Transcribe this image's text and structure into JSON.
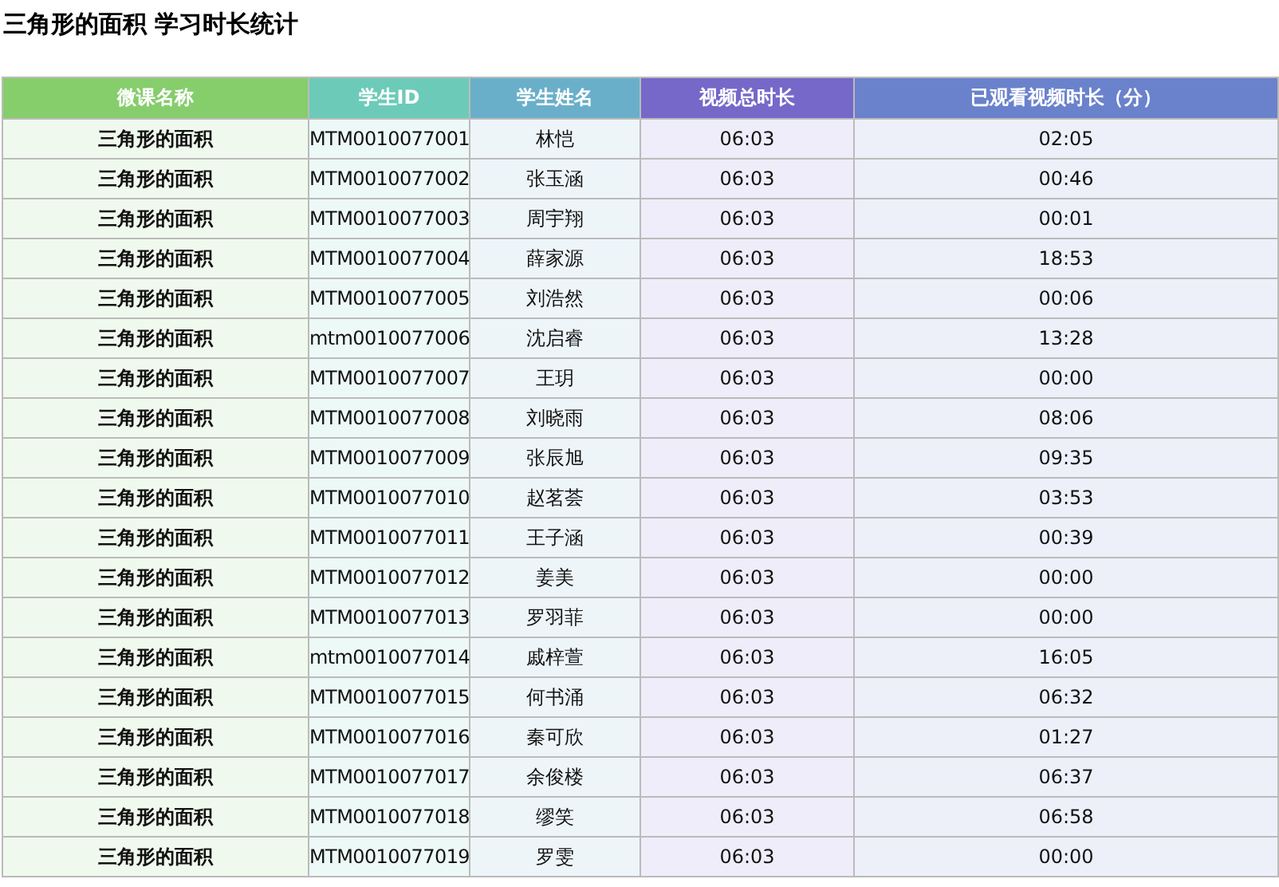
{
  "title": "三角形的面积 学习时长统计",
  "table": {
    "columns": [
      {
        "label": "微课名称",
        "color": "#86cd6c"
      },
      {
        "label": "学生ID",
        "color": "#6ccbb8"
      },
      {
        "label": "学生姓名",
        "color": "#6aafc9"
      },
      {
        "label": "视频总时长",
        "color": "#7568c9"
      },
      {
        "label": "已观看视频时长（分）",
        "color": "#6a82cc"
      }
    ],
    "rows": [
      [
        "三角形的面积",
        "MTM0010077001",
        "林恺",
        "06:03",
        "02:05"
      ],
      [
        "三角形的面积",
        "MTM0010077002",
        "张玉涵",
        "06:03",
        "00:46"
      ],
      [
        "三角形的面积",
        "MTM0010077003",
        "周宇翔",
        "06:03",
        "00:01"
      ],
      [
        "三角形的面积",
        "MTM0010077004",
        "薛家源",
        "06:03",
        "18:53"
      ],
      [
        "三角形的面积",
        "MTM0010077005",
        "刘浩然",
        "06:03",
        "00:06"
      ],
      [
        "三角形的面积",
        "mtm0010077006",
        "沈启睿",
        "06:03",
        "13:28"
      ],
      [
        "三角形的面积",
        "MTM0010077007",
        "王玥",
        "06:03",
        "00:00"
      ],
      [
        "三角形的面积",
        "MTM0010077008",
        "刘晓雨",
        "06:03",
        "08:06"
      ],
      [
        "三角形的面积",
        "MTM0010077009",
        "张辰旭",
        "06:03",
        "09:35"
      ],
      [
        "三角形的面积",
        "MTM0010077010",
        "赵茗荟",
        "06:03",
        "03:53"
      ],
      [
        "三角形的面积",
        "MTM0010077011",
        "王子涵",
        "06:03",
        "00:39"
      ],
      [
        "三角形的面积",
        "MTM0010077012",
        "姜美",
        "06:03",
        "00:00"
      ],
      [
        "三角形的面积",
        "MTM0010077013",
        "罗羽菲",
        "06:03",
        "00:00"
      ],
      [
        "三角形的面积",
        "mtm0010077014",
        "戚梓萱",
        "06:03",
        "16:05"
      ],
      [
        "三角形的面积",
        "MTM0010077015",
        "何书涌",
        "06:03",
        "06:32"
      ],
      [
        "三角形的面积",
        "MTM0010077016",
        "秦可欣",
        "06:03",
        "01:27"
      ],
      [
        "三角形的面积",
        "MTM0010077017",
        "余俊楼",
        "06:03",
        "06:37"
      ],
      [
        "三角形的面积",
        "MTM0010077018",
        "缪笑",
        "06:03",
        "06:58"
      ],
      [
        "三角形的面积",
        "MTM0010077019",
        "罗雯",
        "06:03",
        "00:00"
      ]
    ]
  }
}
